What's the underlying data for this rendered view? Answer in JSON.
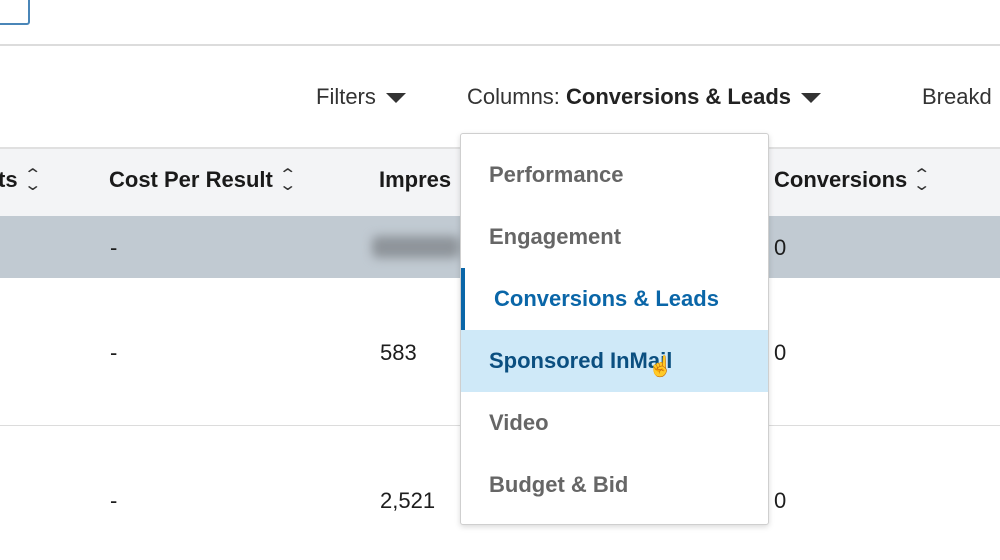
{
  "toolbar": {
    "filters_label": "Filters",
    "columns_prefix": "Columns:",
    "columns_value": "Conversions & Leads",
    "breakdown_label": "Breakd"
  },
  "table": {
    "headers": [
      "ts",
      "Cost Per Result",
      "Impres",
      "Conversions"
    ],
    "rows": [
      {
        "cost_per_result": "-",
        "impressions": "",
        "conversions": "0"
      },
      {
        "cost_per_result": "-",
        "impressions": "583",
        "conversions": "0"
      },
      {
        "cost_per_result": "-",
        "impressions": "2,521",
        "conversions": "0"
      }
    ]
  },
  "columns_menu": {
    "items": [
      "Performance",
      "Engagement",
      "Conversions & Leads",
      "Sponsored InMail",
      "Video",
      "Budget & Bid"
    ],
    "selected": "Conversions & Leads",
    "hovered": "Sponsored InMail"
  },
  "colors": {
    "accent": "#0a66a8",
    "hover_bg": "#cfe9f8",
    "selected_row": "#c1cad2",
    "header_bg": "#f3f4f6"
  }
}
